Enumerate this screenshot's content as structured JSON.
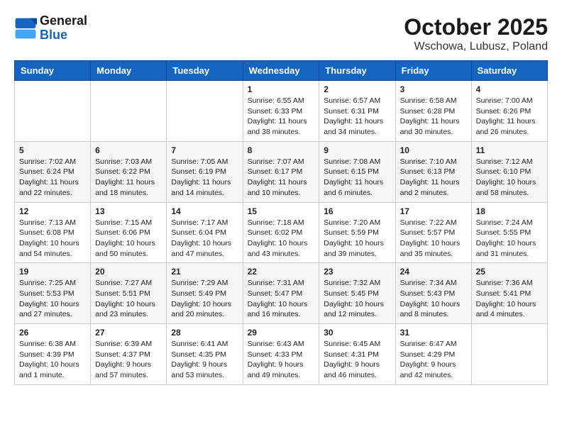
{
  "header": {
    "logo_line1": "General",
    "logo_line2": "Blue",
    "month_title": "October 2025",
    "location": "Wschowa, Lubusz, Poland"
  },
  "weekdays": [
    "Sunday",
    "Monday",
    "Tuesday",
    "Wednesday",
    "Thursday",
    "Friday",
    "Saturday"
  ],
  "weeks": [
    [
      {
        "day": "",
        "info": ""
      },
      {
        "day": "",
        "info": ""
      },
      {
        "day": "",
        "info": ""
      },
      {
        "day": "1",
        "info": "Sunrise: 6:55 AM\nSunset: 6:33 PM\nDaylight: 11 hours\nand 38 minutes."
      },
      {
        "day": "2",
        "info": "Sunrise: 6:57 AM\nSunset: 6:31 PM\nDaylight: 11 hours\nand 34 minutes."
      },
      {
        "day": "3",
        "info": "Sunrise: 6:58 AM\nSunset: 6:28 PM\nDaylight: 11 hours\nand 30 minutes."
      },
      {
        "day": "4",
        "info": "Sunrise: 7:00 AM\nSunset: 6:26 PM\nDaylight: 11 hours\nand 26 minutes."
      }
    ],
    [
      {
        "day": "5",
        "info": "Sunrise: 7:02 AM\nSunset: 6:24 PM\nDaylight: 11 hours\nand 22 minutes."
      },
      {
        "day": "6",
        "info": "Sunrise: 7:03 AM\nSunset: 6:22 PM\nDaylight: 11 hours\nand 18 minutes."
      },
      {
        "day": "7",
        "info": "Sunrise: 7:05 AM\nSunset: 6:19 PM\nDaylight: 11 hours\nand 14 minutes."
      },
      {
        "day": "8",
        "info": "Sunrise: 7:07 AM\nSunset: 6:17 PM\nDaylight: 11 hours\nand 10 minutes."
      },
      {
        "day": "9",
        "info": "Sunrise: 7:08 AM\nSunset: 6:15 PM\nDaylight: 11 hours\nand 6 minutes."
      },
      {
        "day": "10",
        "info": "Sunrise: 7:10 AM\nSunset: 6:13 PM\nDaylight: 11 hours\nand 2 minutes."
      },
      {
        "day": "11",
        "info": "Sunrise: 7:12 AM\nSunset: 6:10 PM\nDaylight: 10 hours\nand 58 minutes."
      }
    ],
    [
      {
        "day": "12",
        "info": "Sunrise: 7:13 AM\nSunset: 6:08 PM\nDaylight: 10 hours\nand 54 minutes."
      },
      {
        "day": "13",
        "info": "Sunrise: 7:15 AM\nSunset: 6:06 PM\nDaylight: 10 hours\nand 50 minutes."
      },
      {
        "day": "14",
        "info": "Sunrise: 7:17 AM\nSunset: 6:04 PM\nDaylight: 10 hours\nand 47 minutes."
      },
      {
        "day": "15",
        "info": "Sunrise: 7:18 AM\nSunset: 6:02 PM\nDaylight: 10 hours\nand 43 minutes."
      },
      {
        "day": "16",
        "info": "Sunrise: 7:20 AM\nSunset: 5:59 PM\nDaylight: 10 hours\nand 39 minutes."
      },
      {
        "day": "17",
        "info": "Sunrise: 7:22 AM\nSunset: 5:57 PM\nDaylight: 10 hours\nand 35 minutes."
      },
      {
        "day": "18",
        "info": "Sunrise: 7:24 AM\nSunset: 5:55 PM\nDaylight: 10 hours\nand 31 minutes."
      }
    ],
    [
      {
        "day": "19",
        "info": "Sunrise: 7:25 AM\nSunset: 5:53 PM\nDaylight: 10 hours\nand 27 minutes."
      },
      {
        "day": "20",
        "info": "Sunrise: 7:27 AM\nSunset: 5:51 PM\nDaylight: 10 hours\nand 23 minutes."
      },
      {
        "day": "21",
        "info": "Sunrise: 7:29 AM\nSunset: 5:49 PM\nDaylight: 10 hours\nand 20 minutes."
      },
      {
        "day": "22",
        "info": "Sunrise: 7:31 AM\nSunset: 5:47 PM\nDaylight: 10 hours\nand 16 minutes."
      },
      {
        "day": "23",
        "info": "Sunrise: 7:32 AM\nSunset: 5:45 PM\nDaylight: 10 hours\nand 12 minutes."
      },
      {
        "day": "24",
        "info": "Sunrise: 7:34 AM\nSunset: 5:43 PM\nDaylight: 10 hours\nand 8 minutes."
      },
      {
        "day": "25",
        "info": "Sunrise: 7:36 AM\nSunset: 5:41 PM\nDaylight: 10 hours\nand 4 minutes."
      }
    ],
    [
      {
        "day": "26",
        "info": "Sunrise: 6:38 AM\nSunset: 4:39 PM\nDaylight: 10 hours\nand 1 minute."
      },
      {
        "day": "27",
        "info": "Sunrise: 6:39 AM\nSunset: 4:37 PM\nDaylight: 9 hours\nand 57 minutes."
      },
      {
        "day": "28",
        "info": "Sunrise: 6:41 AM\nSunset: 4:35 PM\nDaylight: 9 hours\nand 53 minutes."
      },
      {
        "day": "29",
        "info": "Sunrise: 6:43 AM\nSunset: 4:33 PM\nDaylight: 9 hours\nand 49 minutes."
      },
      {
        "day": "30",
        "info": "Sunrise: 6:45 AM\nSunset: 4:31 PM\nDaylight: 9 hours\nand 46 minutes."
      },
      {
        "day": "31",
        "info": "Sunrise: 6:47 AM\nSunset: 4:29 PM\nDaylight: 9 hours\nand 42 minutes."
      },
      {
        "day": "",
        "info": ""
      }
    ]
  ]
}
